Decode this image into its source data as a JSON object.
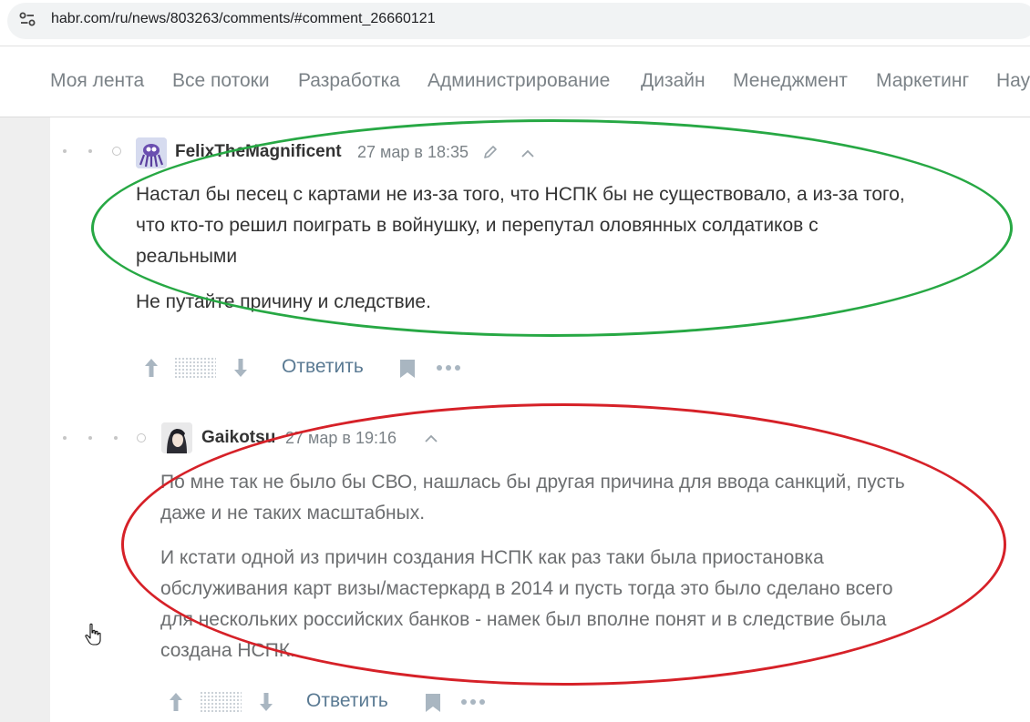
{
  "browser": {
    "url": "habr.com/ru/news/803263/comments/#comment_26660121"
  },
  "nav": {
    "items": [
      "Моя лента",
      "Все потоки",
      "Разработка",
      "Администрирование",
      "Дизайн",
      "Менеджмент",
      "Маркетинг",
      "Нау"
    ]
  },
  "comments": [
    {
      "username": "FelixTheMagnificent",
      "date": "27 мар в 18:35",
      "lines": [
        "Настал бы песец с картами не из-за того, что НСПК бы не существовало, а из-за того,",
        "что кто-то решил поиграть в войнушку, и перепутал оловянных солдатиков с",
        "реальными"
      ],
      "paragraph2": "Не путайте причину и следствие.",
      "reply_label": "Ответить",
      "highlight_color": "#27a844"
    },
    {
      "username": "Gaikotsu",
      "date": "27 мар в 19:16",
      "p1_lines": [
        "По мне так не было бы СВО, нашлась бы другая причина для ввода санкций, пусть",
        "даже и не таких масштабных."
      ],
      "p2_lines": [
        "И кстати одной из причин создания НСПК как раз таки была приостановка",
        "обслуживания карт визы/мастеркард в 2014 и пусть тогда это было сделано всего",
        "для нескольких российских банков - намек был вполне понят и в следствие была",
        "создана НСПК."
      ],
      "reply_label": "Ответить",
      "highlight_color": "#d62128"
    }
  ],
  "icons": [
    "site-info-icon",
    "pencil-icon",
    "chevron-up-icon",
    "arrow-up-icon",
    "arrow-down-icon",
    "bookmark-icon",
    "more-icon",
    "hand-cursor-icon"
  ]
}
